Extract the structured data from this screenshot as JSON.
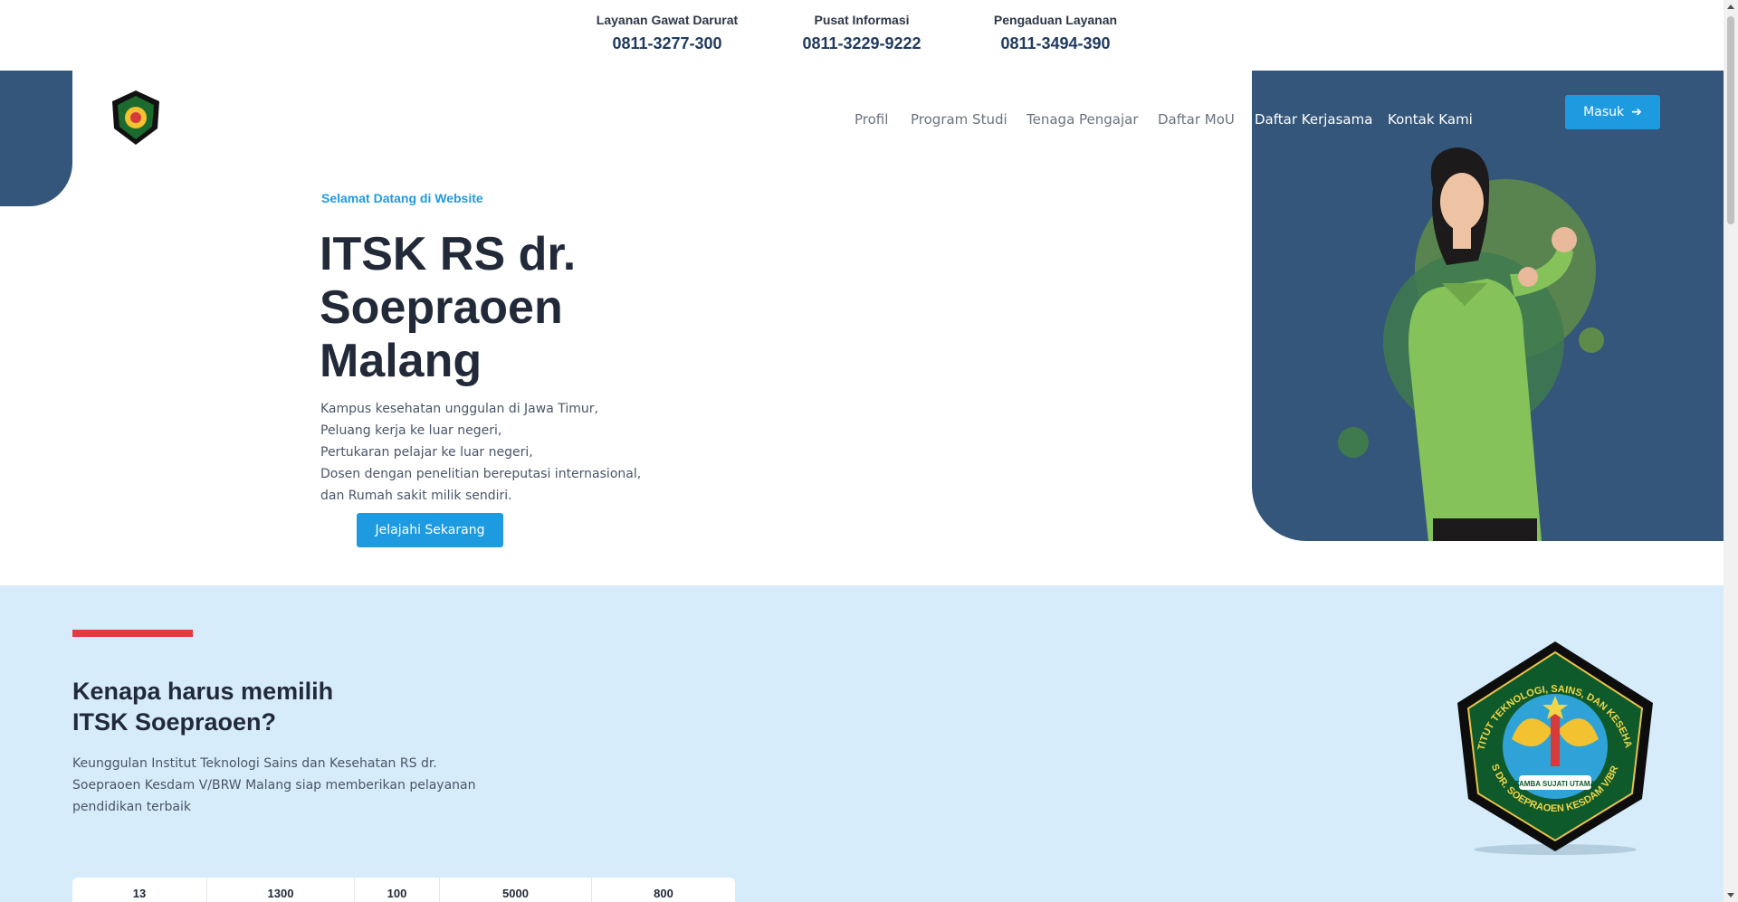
{
  "contacts": [
    {
      "label": "Layanan Gawat Darurat",
      "number": "0811-3277-300"
    },
    {
      "label": "Pusat Informasi",
      "number": "0811-3229-9222"
    },
    {
      "label": "Pengaduan Layanan",
      "number": "0811-3494-390"
    }
  ],
  "nav": {
    "items": [
      "Profil",
      "Program Studi",
      "Tenaga Pengajar",
      "Daftar MoU",
      "Daftar Kerjasama",
      "Kontak Kami"
    ],
    "login_label": "Masuk"
  },
  "hero": {
    "welcome": "Selamat Datang di Website",
    "title": "ITSK RS dr. Soepraoen Malang",
    "desc_lines": [
      "Kampus kesehatan unggulan di Jawa Timur,",
      "Peluang kerja ke luar negeri,",
      "Pertukaran pelajar ke luar negeri,",
      "Dosen dengan penelitian bereputasi internasional,",
      "dan Rumah sakit milik sendiri."
    ],
    "cta_label": "Jelajahi Sekarang"
  },
  "why": {
    "title_line1": "Kenapa harus memilih",
    "title_line2": "ITSK Soepraoen?",
    "text": "Keunggulan Institut Teknologi Sains dan Kesehatan RS dr. Soepraoen Kesdam V/BRW Malang siap memberikan pelayanan pendidikan terbaik",
    "stats": [
      "13",
      "1300",
      "100",
      "5000",
      "800"
    ]
  },
  "emblem": {
    "ring_text_top": "INSTITUT TEKNOLOGI, SAINS, DAN KESEHATAN",
    "ring_text_bottom": "RS DR. SOEPRAOEN KESDAM V/BRW",
    "motto": "TAMBA SUJATI UTAMA"
  },
  "colors": {
    "accent": "#1e9be0",
    "panel": "#34567a",
    "red": "#e53940",
    "section_bg": "#d6ecfa"
  }
}
